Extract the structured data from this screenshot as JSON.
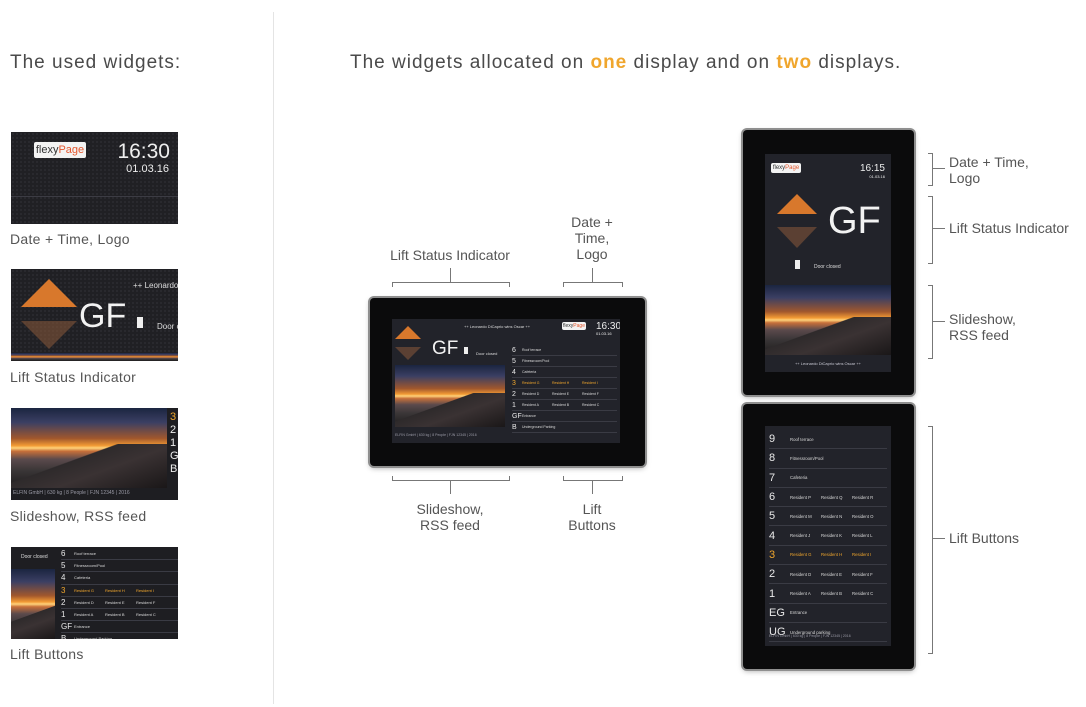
{
  "left_header": "The used widgets:",
  "right_header": {
    "prefix": "The widgets allocated on ",
    "one": "one",
    "middle": " display and on ",
    "two": "two",
    "suffix": " displays."
  },
  "widgets": {
    "datetime": {
      "caption": "Date + Time, Logo",
      "logo_a": "flexy",
      "logo_b": "Page",
      "time": "16:30",
      "date": "01.03.16"
    },
    "lift_status": {
      "caption": "Lift Status Indicator",
      "floor": "GF",
      "door": "Door cl",
      "ticker": "++ Leonardo D"
    },
    "slideshow": {
      "caption": "Slideshow, RSS feed",
      "footer": "ELFIN GmbH | 630 kg | 8 People | FJN 12345 | 2016",
      "floors": [
        "3",
        "2",
        "1",
        "G",
        "B"
      ]
    },
    "buttons": {
      "caption": "Lift Buttons",
      "door": "Door closed"
    }
  },
  "one_display": {
    "labels": {
      "lift_status": "Lift Status Indicator",
      "datetime_1": "Date +",
      "datetime_2": "Time,",
      "datetime_3": "Logo",
      "slideshow_1": "Slideshow,",
      "slideshow_2": "RSS feed",
      "buttons_1": "Lift",
      "buttons_2": "Buttons"
    },
    "ticker": "++ Leonardo DiCaprio wins Oscar ++",
    "logo_a": "flexy",
    "logo_b": "Page",
    "time": "16:30",
    "date": "01.03.16",
    "floor": "GF",
    "door": "Door closed",
    "footer": "ELFIN GmbH | 630 kg | 8 People | FJN 12345 | 2016",
    "rows": [
      {
        "num": "6",
        "cells": [
          "Roof terrace"
        ]
      },
      {
        "num": "5",
        "cells": [
          "Fitnessroom/Pool"
        ]
      },
      {
        "num": "4",
        "cells": [
          "Cafeteria"
        ]
      },
      {
        "num": "3",
        "cells": [
          "Resident G",
          "Resident H",
          "Resident I"
        ],
        "current": true
      },
      {
        "num": "2",
        "cells": [
          "Resident D",
          "Resident E",
          "Resident F"
        ]
      },
      {
        "num": "1",
        "cells": [
          "Resident A",
          "Resident B",
          "Resident C"
        ]
      },
      {
        "num": "GF",
        "cells": [
          "Entrance"
        ]
      },
      {
        "num": "B",
        "cells": [
          "Underground Parking"
        ]
      }
    ]
  },
  "two_displays": {
    "labels": {
      "datetime_1": "Date + Time,",
      "datetime_2": "Logo",
      "lift_status": "Lift Status Indicator",
      "slideshow_1": "Slideshow,",
      "slideshow_2": "RSS feed",
      "buttons": "Lift Buttons"
    },
    "top": {
      "logo_a": "flexy",
      "logo_b": "Page",
      "time": "16:15",
      "date": "01.03.16",
      "floor": "GF",
      "door": "Door closed",
      "ticker": "++ Leonardo DiCaprio wins Oscar ++"
    },
    "bottom": {
      "footer": "ELFIN GmbH | 630 kg | 8 People | FJN 12345 | 2016",
      "rows": [
        {
          "num": "9",
          "cells": [
            "Roof terrace"
          ]
        },
        {
          "num": "8",
          "cells": [
            "Fitnessroom/Pool"
          ]
        },
        {
          "num": "7",
          "cells": [
            "Cafeteria"
          ]
        },
        {
          "num": "6",
          "cells": [
            "Resident P",
            "Resident Q",
            "Resident R"
          ]
        },
        {
          "num": "5",
          "cells": [
            "Resident M",
            "Resident N",
            "Resident O"
          ]
        },
        {
          "num": "4",
          "cells": [
            "Resident J",
            "Resident K",
            "Resident L"
          ]
        },
        {
          "num": "3",
          "cells": [
            "Resident G",
            "Resident H",
            "Resident I"
          ],
          "current": true
        },
        {
          "num": "2",
          "cells": [
            "Resident D",
            "Resident E",
            "Resident F"
          ]
        },
        {
          "num": "1",
          "cells": [
            "Resident A",
            "Resident B",
            "Resident C"
          ]
        },
        {
          "num": "EG",
          "cells": [
            "Entrance"
          ]
        },
        {
          "num": "UG",
          "cells": [
            "Underground parking"
          ]
        }
      ]
    }
  },
  "colors": {
    "accent": "#f0a62d",
    "screen": "#22232a",
    "frame": "#0b0b0c"
  }
}
